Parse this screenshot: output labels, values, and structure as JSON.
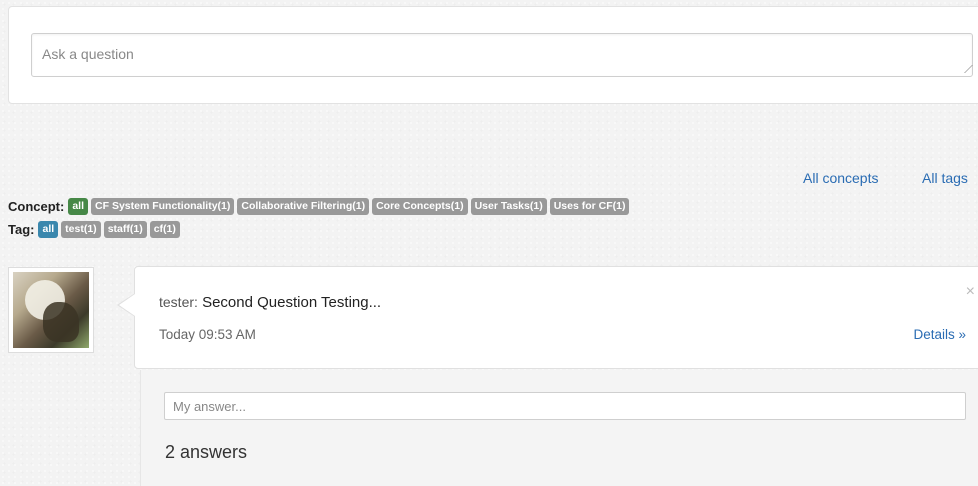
{
  "ask": {
    "placeholder": "Ask a question"
  },
  "nav": {
    "all_concepts": "All concepts",
    "all_tags": "All tags"
  },
  "filters": {
    "concept_label": "Concept:",
    "concepts": [
      "all",
      "CF System Functionality(1)",
      "Collaborative Filtering(1)",
      "Core Concepts(1)",
      "User Tasks(1)",
      "Uses for CF(1)"
    ],
    "tag_label": "Tag:",
    "tags": [
      "all",
      "test(1)",
      "staff(1)",
      "cf(1)"
    ]
  },
  "question": {
    "user": "tester:",
    "title": "Second Question Testing...",
    "time": "Today 09:53 AM",
    "details": "Details »",
    "close": "×"
  },
  "answers": {
    "placeholder": "My answer...",
    "count_label": "2 answers"
  },
  "colors": {
    "link": "#2a6cb3",
    "badge_selected_concept": "#468847",
    "badge_selected_tag": "#3a87ad",
    "badge_default": "#999999"
  }
}
